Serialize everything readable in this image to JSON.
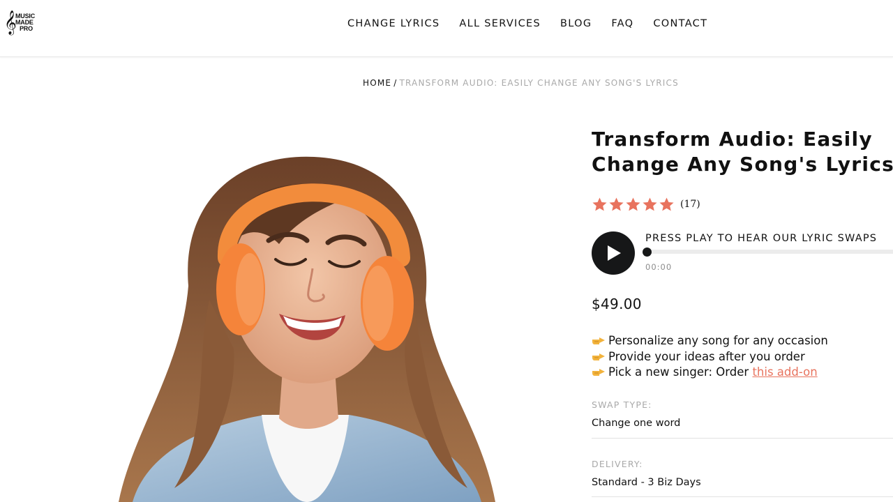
{
  "header": {
    "logo": {
      "line1": "MUSIC",
      "line2": "MADE",
      "line3": "PRO"
    },
    "nav": [
      {
        "label": "CHANGE LYRICS"
      },
      {
        "label": "ALL SERVICES"
      },
      {
        "label": "BLOG"
      },
      {
        "label": "FAQ"
      },
      {
        "label": "CONTACT"
      }
    ]
  },
  "breadcrumb": {
    "home": "HOME",
    "separator": "/",
    "current": "TRANSFORM AUDIO: EASILY CHANGE ANY SONG'S LYRICS"
  },
  "hero": {
    "description_icon": "smiling-woman-with-headphones-image"
  },
  "product": {
    "title_line1": "Transform Audio: Easily",
    "title_line2": "Change Any Song's Lyrics",
    "rating": {
      "stars": 5,
      "max": 5,
      "count": "(17)"
    },
    "player": {
      "label": "PRESS PLAY TO HEAR OUR LYRIC SWAPS",
      "time": "00:00",
      "progress": 0
    },
    "price": "$49.00",
    "features": [
      {
        "icon": "pointing-hand-icon",
        "text": "Personalize any song for any occasion"
      },
      {
        "icon": "pointing-hand-icon",
        "text": "Provide your ideas after you order"
      },
      {
        "icon": "pointing-hand-icon",
        "text": "Pick a new singer: Order ",
        "link": "this add-on"
      }
    ],
    "swap_type": {
      "label": "SWAP TYPE:",
      "value": "Change one word"
    },
    "delivery": {
      "label": "DELIVERY:",
      "value": "Standard - 3 Biz Days"
    }
  },
  "colors": {
    "accent": "#e8735e",
    "text": "#111111",
    "muted": "#a9a9a9",
    "button": "#161718"
  }
}
